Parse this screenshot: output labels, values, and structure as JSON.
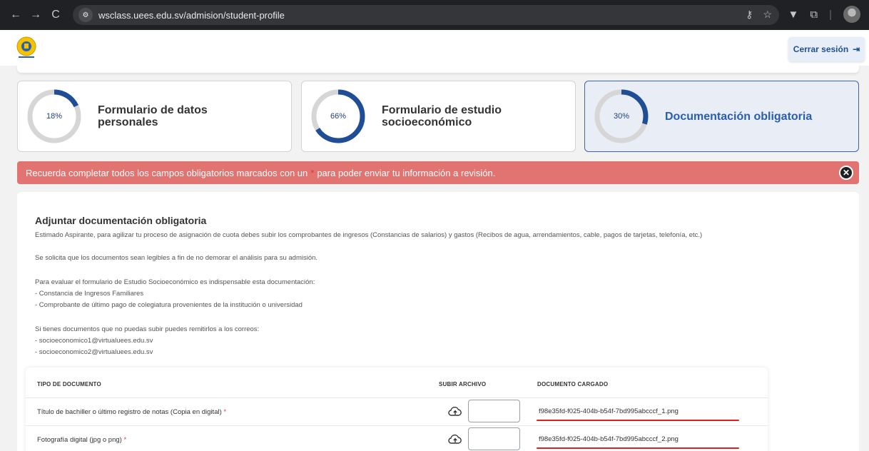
{
  "browser": {
    "url": "wsclass.uees.edu.sv/admision/student-profile",
    "back_icon": "arrow-left-icon",
    "forward_icon": "arrow-right-icon",
    "reload_icon": "reload-icon",
    "back_glyph": "←",
    "forward_glyph": "→",
    "reload_glyph": "C",
    "site_glyph": "⚙",
    "key_glyph": "⚷",
    "star_glyph": "☆",
    "ext_glyph": "▼",
    "puzzle_glyph": "⧉",
    "sep_glyph": "|"
  },
  "header": {
    "logout_label": "Cerrar sesión",
    "logout_glyph": "⇥"
  },
  "cards": [
    {
      "percent_label": "18%",
      "percent": 18,
      "title": "Formulario de datos personales"
    },
    {
      "percent_label": "66%",
      "percent": 66,
      "title": "Formulario de estudio socioeconómico"
    },
    {
      "percent_label": "30%",
      "percent": 30,
      "title": "Documentación obligatoria"
    }
  ],
  "alert": {
    "text_before": "Recuerda completar todos los campos obligatorios marcados con un",
    "star": "*",
    "text_after": "para poder enviar tu información a revisión.",
    "close_glyph": "✕"
  },
  "section": {
    "title": "Adjuntar documentación obligatoria",
    "p1": "Estimado Aspirante, para agilizar tu proceso de asignación de cuota debes subir los comprobantes de ingresos (Constancias de salarios) y gastos (Recibos de agua, arrendamientos, cable, pagos de tarjetas, telefonía, etc.)",
    "p2": "Se solicita que los documentos sean legibles a fin de no demorar el análisis para su admisión.",
    "p3": "Para evaluar el formulario de Estudio Socioeconómico es indispensable esta documentación:",
    "p3_item1": "- Constancia de Ingresos Familiares",
    "p3_item2": "- Comprobante de último pago de colegiatura provenientes de la institución o universidad",
    "p4": "Si tienes documentos que no puedas subir puedes remitirlos a los correos:",
    "p4_item1": "- socioeconomico1@virtualuees.edu.sv",
    "p4_item2": "- socioeconomico2@virtualuees.edu.sv"
  },
  "table": {
    "col_doc": "TIPO DE DOCUMENTO",
    "col_upload": "SUBIR ARCHIVO",
    "col_file": "DOCUMENTO CARGADO",
    "rows": [
      {
        "doc": "Título de bachiller o último registro de notas (Copia en digital)",
        "req": "*",
        "file": "f98e35fd-f025-404b-b54f-7bd995abcccf_1.png"
      },
      {
        "doc": "Fotografía digital (jpg o png)",
        "req": "*",
        "file": "f98e35fd-f025-404b-b54f-7bd995abcccf_2.png"
      }
    ]
  },
  "colors": {
    "brand_blue": "#1f4d96",
    "ring_track": "#d6d6d6",
    "alert_bg": "#e17371",
    "underline_red": "#e02020"
  }
}
